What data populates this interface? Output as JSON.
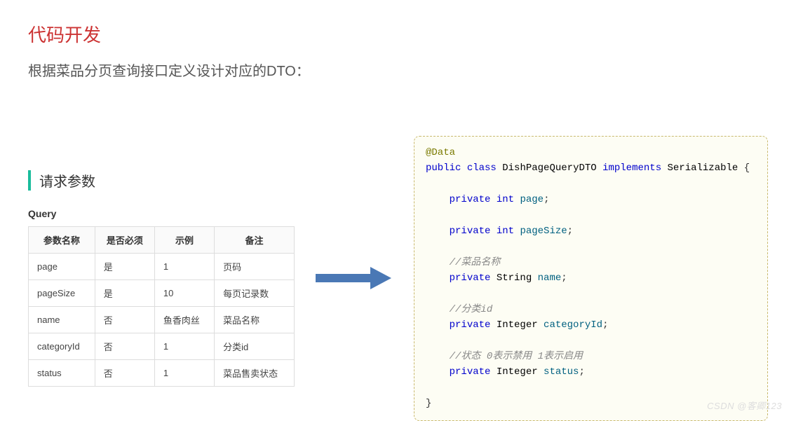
{
  "heading": "代码开发",
  "subtext": "根据菜品分页查询接口定义设计对应的DTO：",
  "section_title": "请求参数",
  "query_label": "Query",
  "table": {
    "headers": [
      "参数名称",
      "是否必须",
      "示例",
      "备注"
    ],
    "rows": [
      [
        "page",
        "是",
        "1",
        "页码"
      ],
      [
        "pageSize",
        "是",
        "10",
        "每页记录数"
      ],
      [
        "name",
        "否",
        "鱼香肉丝",
        "菜品名称"
      ],
      [
        "categoryId",
        "否",
        "1",
        "分类id"
      ],
      [
        "status",
        "否",
        "1",
        "菜品售卖状态"
      ]
    ]
  },
  "code": {
    "anno": "@Data",
    "kw_public": "public",
    "kw_class": "class",
    "classname": "DishPageQueryDTO",
    "kw_implements": "implements",
    "serializable": "Serializable",
    "brace_open": " {",
    "brace_close": "}",
    "lines": [
      {
        "mod": "private",
        "type": "int",
        "name": "page",
        "semi": ";"
      },
      {
        "mod": "private",
        "type": "int",
        "name": "pageSize",
        "semi": ";"
      },
      {
        "comment": "//菜品名称"
      },
      {
        "mod": "private",
        "type": "String",
        "name": "name",
        "semi": ";"
      },
      {
        "comment": "//分类id"
      },
      {
        "mod": "private",
        "type": "Integer",
        "name": "categoryId",
        "semi": ";"
      },
      {
        "comment": "//状态 0表示禁用 1表示启用"
      },
      {
        "mod": "private",
        "type": "Integer",
        "name": "status",
        "semi": ";"
      }
    ]
  },
  "watermark": "CSDN @客卿123"
}
